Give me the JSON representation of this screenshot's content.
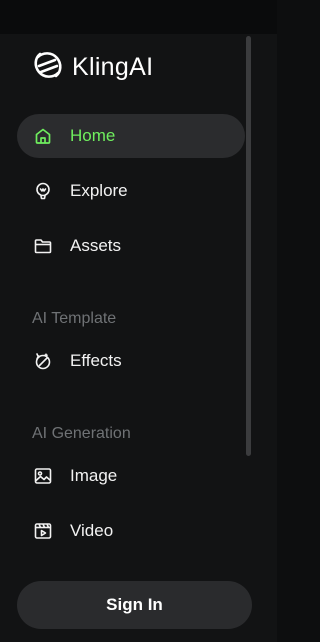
{
  "brand": {
    "name": "KlingAI",
    "icon": "kling-logo-icon"
  },
  "nav": {
    "home": {
      "label": "Home",
      "icon": "home-icon",
      "active": true
    },
    "explore": {
      "label": "Explore",
      "icon": "explore-icon"
    },
    "assets": {
      "label": "Assets",
      "icon": "folder-icon"
    }
  },
  "sections": {
    "template": {
      "title": "AI Template",
      "effects": {
        "label": "Effects",
        "icon": "magic-wand-icon"
      }
    },
    "generation": {
      "title": "AI Generation",
      "image": {
        "label": "Image",
        "icon": "image-icon"
      },
      "video": {
        "label": "Video",
        "icon": "video-icon"
      }
    }
  },
  "auth": {
    "signin_label": "Sign In"
  },
  "colors": {
    "accent": "#6fee5e",
    "background": "#121314",
    "active_bg": "#2b2c2e",
    "muted_text": "#6f7275"
  }
}
